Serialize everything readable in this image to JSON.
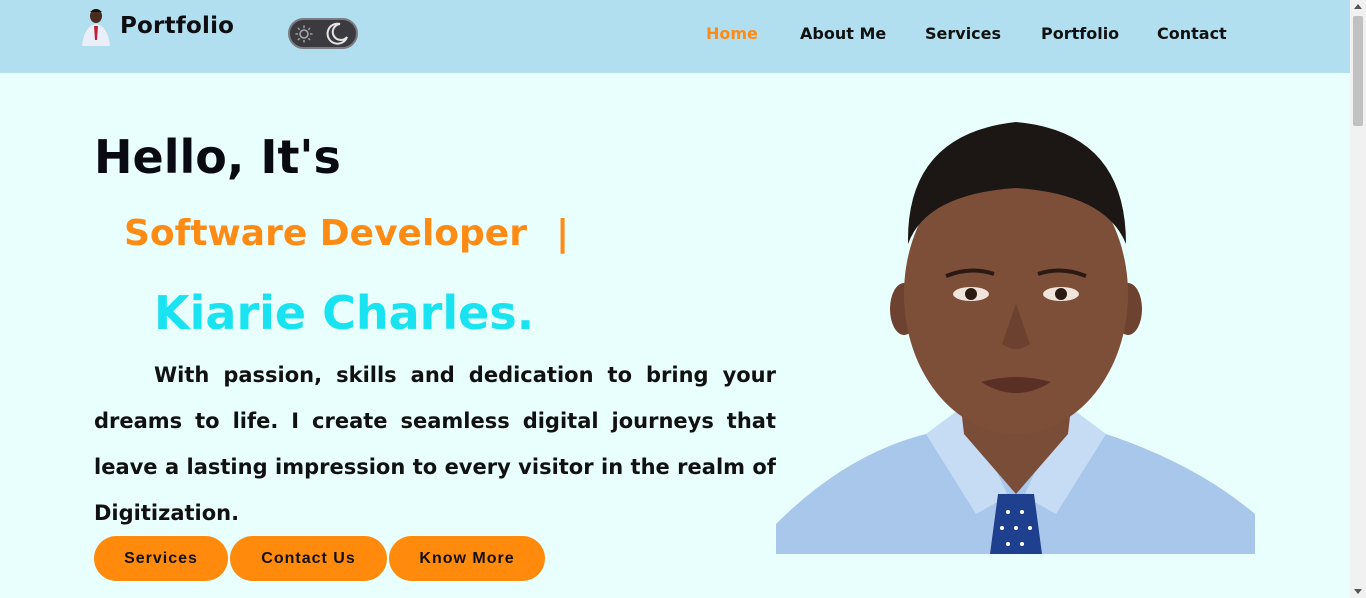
{
  "header": {
    "logo_text": "Portfolio",
    "theme_toggle": {
      "sun_icon": "sun-icon",
      "moon_icon": "moon-icon"
    },
    "nav": [
      {
        "label": "Home",
        "active": true
      },
      {
        "label": "About Me",
        "active": false
      },
      {
        "label": "Services",
        "active": false
      },
      {
        "label": "Portfolio",
        "active": false
      },
      {
        "label": "Contact",
        "active": false
      }
    ]
  },
  "hero": {
    "greeting": "Hello, It's",
    "role": "Software Developer",
    "cursor": "|",
    "name": "Kiarie Charles.",
    "intro": "With passion, skills and dedication to bring your dreams to life. I create seamless digital journeys that leave a lasting impression to every visitor in the realm of Digitization.",
    "buttons": [
      {
        "label": "Services"
      },
      {
        "label": "Contact Us"
      },
      {
        "label": "Know More"
      }
    ]
  },
  "colors": {
    "accent": "#ff8a14",
    "name": "#19e3f0",
    "header_bg": "#b1dfef",
    "page_bg": "#e8fffd"
  }
}
